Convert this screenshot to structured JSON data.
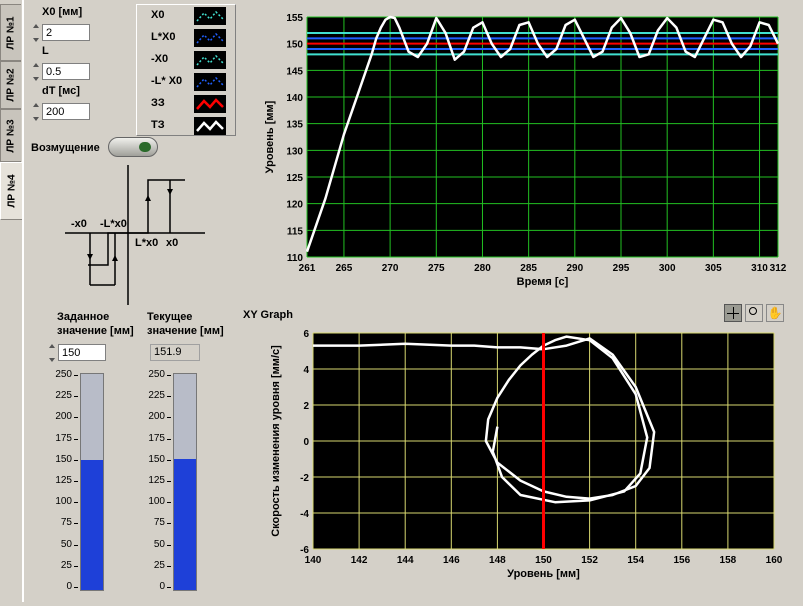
{
  "tabs": [
    "ЛР №1",
    "ЛР №2",
    "ЛР №3",
    "ЛР №4"
  ],
  "controls": {
    "x0": {
      "label": "X0 [мм]",
      "value": "2"
    },
    "l": {
      "label": "L",
      "value": "0.5"
    },
    "dt": {
      "label": "dT [мс]",
      "value": "200"
    },
    "disturbance_label": "Возмущение"
  },
  "legend": [
    {
      "label": "X0",
      "color": "#40e0d0",
      "style": "dotted"
    },
    {
      "label": "L*X0",
      "color": "#2060ff",
      "style": "dotted"
    },
    {
      "label": "-X0",
      "color": "#40e0d0",
      "style": "dotted"
    },
    {
      "label": "-L* X0",
      "color": "#2060ff",
      "style": "dotted"
    },
    {
      "label": "ЗЗ",
      "color": "#ff0000",
      "style": "solid"
    },
    {
      "label": "ТЗ",
      "color": "#ffffff",
      "style": "solid"
    }
  ],
  "relay_diagram": {
    "labels": [
      "-x0",
      "-L*x0",
      "L*x0",
      "x0"
    ]
  },
  "setpoint": {
    "label_line1": "Заданное",
    "label_line2": "значение [мм]",
    "value": "150",
    "level": 150,
    "max": 250
  },
  "current": {
    "label_line1": "Текущее",
    "label_line2": "значение [мм]",
    "value": "151.9",
    "level": 151.9,
    "max": 250
  },
  "tank_ticks": [
    "250",
    "225",
    "200",
    "175",
    "150",
    "125",
    "100",
    "75",
    "50",
    "25",
    "0"
  ],
  "xy_title": "XY Graph",
  "chart_data": [
    {
      "type": "line",
      "xlabel": "Время [с]",
      "ylabel": "Уровень [мм]",
      "xlim": [
        261,
        312
      ],
      "ylim": [
        110,
        155
      ],
      "xticks": [
        261,
        265,
        270,
        275,
        280,
        285,
        290,
        295,
        300,
        305,
        310,
        312
      ],
      "yticks": [
        110,
        115,
        120,
        125,
        130,
        135,
        140,
        145,
        150,
        155
      ],
      "grid": true,
      "series": [
        {
          "name": "X0",
          "color": "#40e0d0",
          "y": 152
        },
        {
          "name": "L*X0",
          "color": "#2060ff",
          "y": 151
        },
        {
          "name": "-X0",
          "color": "#40e0d0",
          "y": 148
        },
        {
          "name": "-L* X0",
          "color": "#2060ff",
          "y": 149
        },
        {
          "name": "ЗЗ",
          "color": "#ff0000",
          "y": 150
        },
        {
          "name": "ТЗ",
          "color": "#ffffff",
          "x": [
            261,
            262,
            263,
            264,
            265,
            266,
            267,
            268,
            268.5,
            269,
            269.5,
            270,
            270.5,
            271,
            272,
            273,
            274,
            275,
            276,
            277,
            278,
            279,
            280,
            281,
            282,
            283,
            284,
            285,
            286,
            287,
            288,
            289,
            290,
            291,
            292,
            293,
            294,
            295,
            296,
            297,
            298,
            299,
            300,
            301,
            302,
            303,
            304,
            305,
            306,
            307,
            308,
            309,
            310,
            311,
            312
          ],
          "values": [
            111,
            116,
            121,
            127,
            133,
            138,
            143,
            148,
            151,
            153,
            154.5,
            155,
            154.8,
            153,
            148.5,
            147.5,
            150,
            154.8,
            152,
            147,
            148.5,
            153,
            154,
            150,
            147.5,
            149,
            153.5,
            154,
            150,
            147.5,
            149,
            153.5,
            154.5,
            151,
            147.5,
            148.5,
            153,
            154.8,
            152,
            147.5,
            148,
            152.5,
            154.8,
            153,
            148.5,
            147.5,
            151,
            154.5,
            154,
            150,
            147.5,
            149.5,
            154,
            153.5,
            150
          ]
        }
      ]
    },
    {
      "type": "scatter",
      "xlabel": "Уровень [мм]",
      "ylabel": "Скорость изменения уровня [мм/с]",
      "xlim": [
        140,
        160
      ],
      "ylim": [
        -6,
        6
      ],
      "xticks": [
        140,
        142,
        144,
        146,
        148,
        150,
        152,
        154,
        156,
        158,
        160
      ],
      "yticks": [
        -6,
        -4,
        -2,
        0,
        2,
        4,
        6
      ],
      "grid": true,
      "series": [
        {
          "name": "ТЗ",
          "color": "#ffffff",
          "x": [
            140,
            142,
            144,
            146,
            147,
            148,
            149,
            150,
            151,
            152,
            153,
            154,
            154.8,
            154.6,
            154,
            153,
            152,
            151,
            150,
            149,
            148,
            147.5,
            147.6,
            148,
            148.5,
            149,
            149.5,
            150,
            150.5,
            151,
            152,
            153,
            154,
            154.5,
            154.2,
            153.5,
            152,
            150.5,
            149,
            148.2,
            147.8,
            148
          ],
          "values": [
            5.3,
            5.3,
            5.4,
            5.3,
            5.3,
            5.2,
            5.2,
            5.1,
            5.3,
            5.7,
            4.8,
            3,
            0.5,
            -1.5,
            -2.5,
            -3,
            -3.2,
            -3.1,
            -2.8,
            -2.2,
            -1.2,
            0,
            1.2,
            2.4,
            3.4,
            4.2,
            4.8,
            5.3,
            5.6,
            5.8,
            5.6,
            4.6,
            2.6,
            0.2,
            -1.8,
            -2.8,
            -3.3,
            -3.4,
            -3.0,
            -2.0,
            -0.6,
            0.8
          ]
        },
        {
          "name": "ЗЗ",
          "color": "#ff0000",
          "x": [
            150,
            150
          ],
          "values": [
            -6,
            6
          ]
        }
      ]
    }
  ]
}
